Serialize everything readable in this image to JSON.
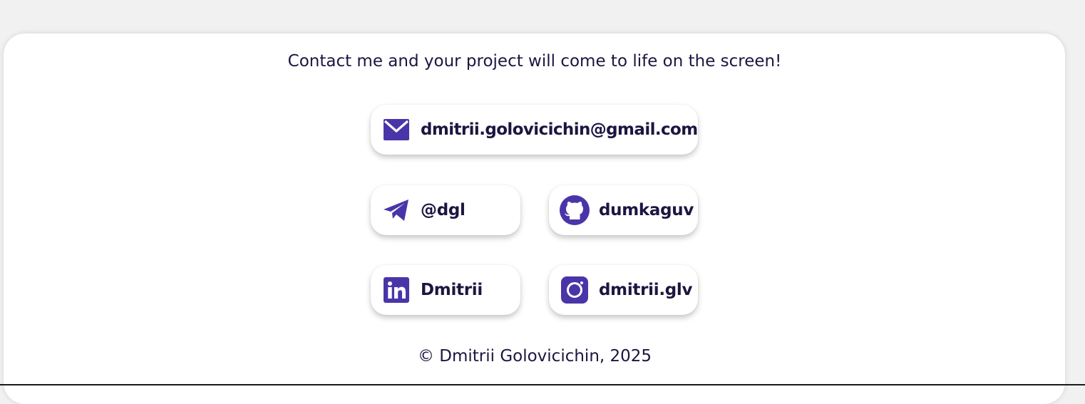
{
  "colors": {
    "accent": "#4a35a8",
    "text": "#1b1640",
    "background": "#f1f1f1",
    "card": "#ffffff"
  },
  "contact": {
    "tagline": "Contact me and your project will come to life on the screen!",
    "links": {
      "email": {
        "icon": "envelope-icon",
        "label": "dmitrii.golovicichin@gmail.com"
      },
      "telegram": {
        "icon": "telegram-icon",
        "label": "@dgl"
      },
      "github": {
        "icon": "github-icon",
        "label": "dumkaguv"
      },
      "linkedin": {
        "icon": "linkedin-icon",
        "label": "Dmitrii"
      },
      "instagram": {
        "icon": "instagram-icon",
        "label": "dmitrii.glv"
      }
    }
  },
  "footer": {
    "copyright": "© Dmitrii Golovicichin, 2025"
  }
}
